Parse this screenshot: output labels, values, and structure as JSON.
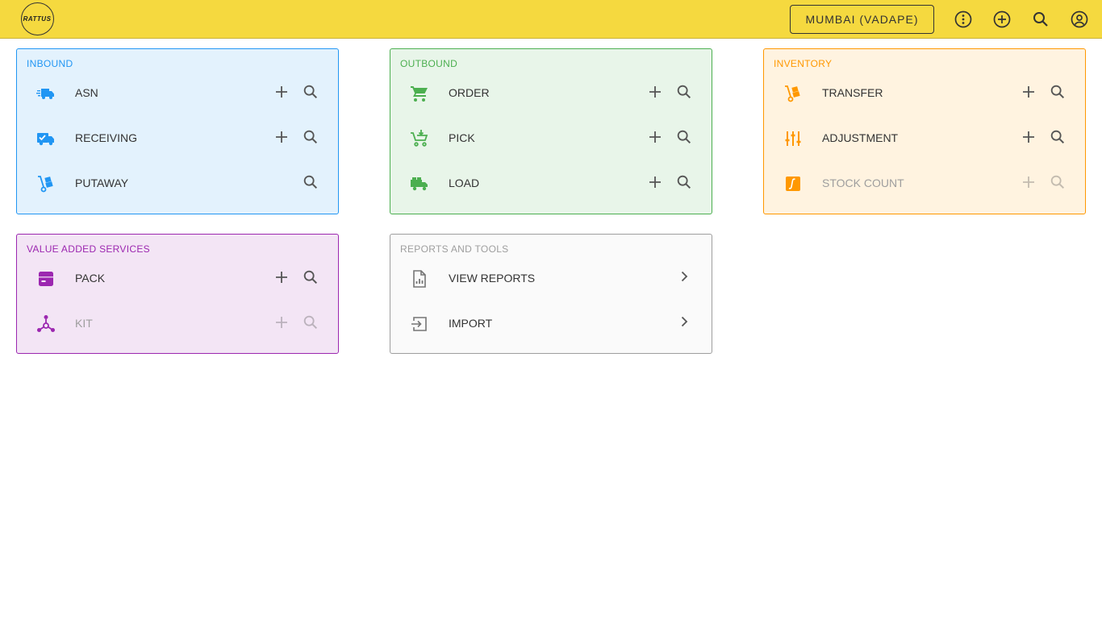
{
  "header": {
    "logo_text": "RATTUS",
    "location_label": "MUMBAI (VADAPE)",
    "icons": [
      "more-vertical-icon",
      "add-circle-icon",
      "search-icon",
      "account-circle-icon"
    ]
  },
  "colors": {
    "topbar": "#f5d93f",
    "inbound": "#2196f3",
    "inbound_bg": "#e3f2fd",
    "outbound": "#4caf50",
    "outbound_bg": "#e8f5e9",
    "inventory": "#ff9800",
    "inventory_bg": "#fff3e0",
    "vas": "#9c27b0",
    "vas_bg": "#f3e5f5",
    "reports": "#9e9e9e",
    "reports_bg": "#fafafa"
  },
  "inbound": {
    "title": "INBOUND",
    "items": [
      {
        "label": "ASN",
        "icon": "fast-truck-icon"
      },
      {
        "label": "RECEIVING",
        "icon": "truck-check-icon"
      },
      {
        "label": "PUTAWAY",
        "icon": "hand-truck-icon"
      }
    ]
  },
  "outbound": {
    "title": "OUTBOUND",
    "items": [
      {
        "label": "ORDER",
        "icon": "cart-icon"
      },
      {
        "label": "PICK",
        "icon": "cart-arrow-down-icon"
      },
      {
        "label": "LOAD",
        "icon": "loaded-truck-icon"
      }
    ]
  },
  "inventory": {
    "title": "INVENTORY",
    "items": [
      {
        "label": "TRANSFER",
        "icon": "hand-truck-icon"
      },
      {
        "label": "ADJUSTMENT",
        "icon": "tune-icon"
      },
      {
        "label": "STOCK COUNT",
        "icon": "integral-icon"
      }
    ]
  },
  "vas": {
    "title": "VALUE ADDED SERVICES",
    "items": [
      {
        "label": "PACK",
        "icon": "package-box-icon"
      },
      {
        "label": "KIT",
        "icon": "hub-icon"
      }
    ]
  },
  "reports": {
    "title": "REPORTS AND TOOLS",
    "items": [
      {
        "label": "VIEW REPORTS",
        "icon": "report-file-icon"
      },
      {
        "label": "IMPORT",
        "icon": "import-icon"
      }
    ]
  }
}
